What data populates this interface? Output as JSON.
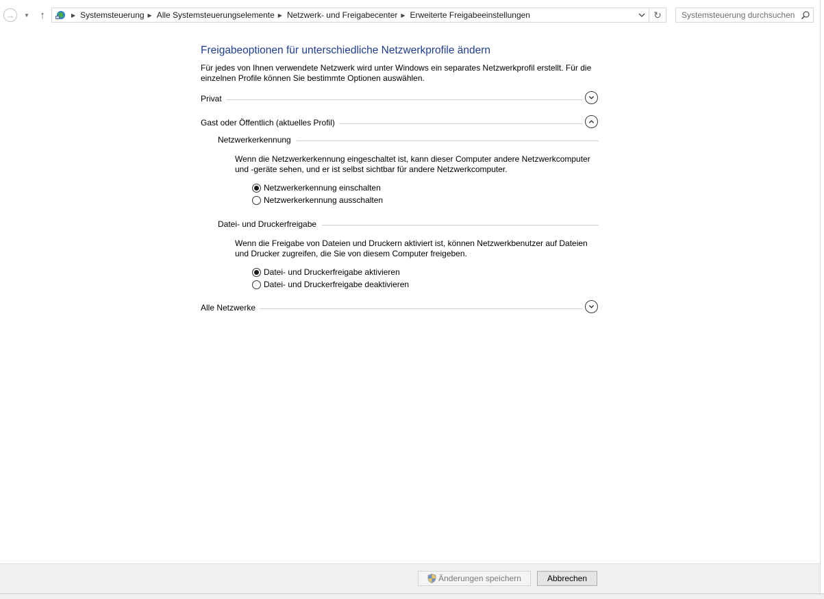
{
  "address_bar": {
    "breadcrumbs": [
      "Systemsteuerung",
      "Alle Systemsteuerungselemente",
      "Netzwerk- und Freigabecenter",
      "Erweiterte Freigabeeinstellungen"
    ],
    "search_placeholder": "Systemsteuerung durchsuchen"
  },
  "page": {
    "title": "Freigabeoptionen für unterschiedliche Netzwerkprofile ändern",
    "intro": "Für jedes von Ihnen verwendete Netzwerk wird unter Windows ein separates Netzwerkprofil erstellt. Für die einzelnen Profile können Sie bestimmte Optionen auswählen."
  },
  "profiles": {
    "private": {
      "label": "Privat",
      "expanded": false
    },
    "guest_public": {
      "label": "Gast oder Öffentlich (aktuelles Profil)",
      "expanded": true,
      "network_discovery": {
        "title": "Netzwerkerkennung",
        "description": "Wenn die Netzwerkerkennung eingeschaltet ist, kann dieser Computer andere Netzwerkcomputer und -geräte sehen, und er ist selbst sichtbar für andere Netzwerkcomputer.",
        "options": [
          {
            "label": "Netzwerkerkennung einschalten",
            "selected": true
          },
          {
            "label": "Netzwerkerkennung ausschalten",
            "selected": false
          }
        ]
      },
      "file_printer_sharing": {
        "title": "Datei- und Druckerfreigabe",
        "description": "Wenn die Freigabe von Dateien und Druckern aktiviert ist, können Netzwerkbenutzer auf Dateien und Drucker zugreifen, die Sie von diesem Computer freigeben.",
        "options": [
          {
            "label": "Datei- und Druckerfreigabe aktivieren",
            "selected": true
          },
          {
            "label": "Datei- und Druckerfreigabe deaktivieren",
            "selected": false
          }
        ]
      }
    },
    "all_networks": {
      "label": "Alle Netzwerke",
      "expanded": false
    }
  },
  "footer": {
    "save_label": "Änderungen speichern",
    "save_enabled": false,
    "cancel_label": "Abbrechen"
  },
  "colors": {
    "title_blue": "#1e3d8f",
    "footer_bg": "#f0f0f0"
  }
}
